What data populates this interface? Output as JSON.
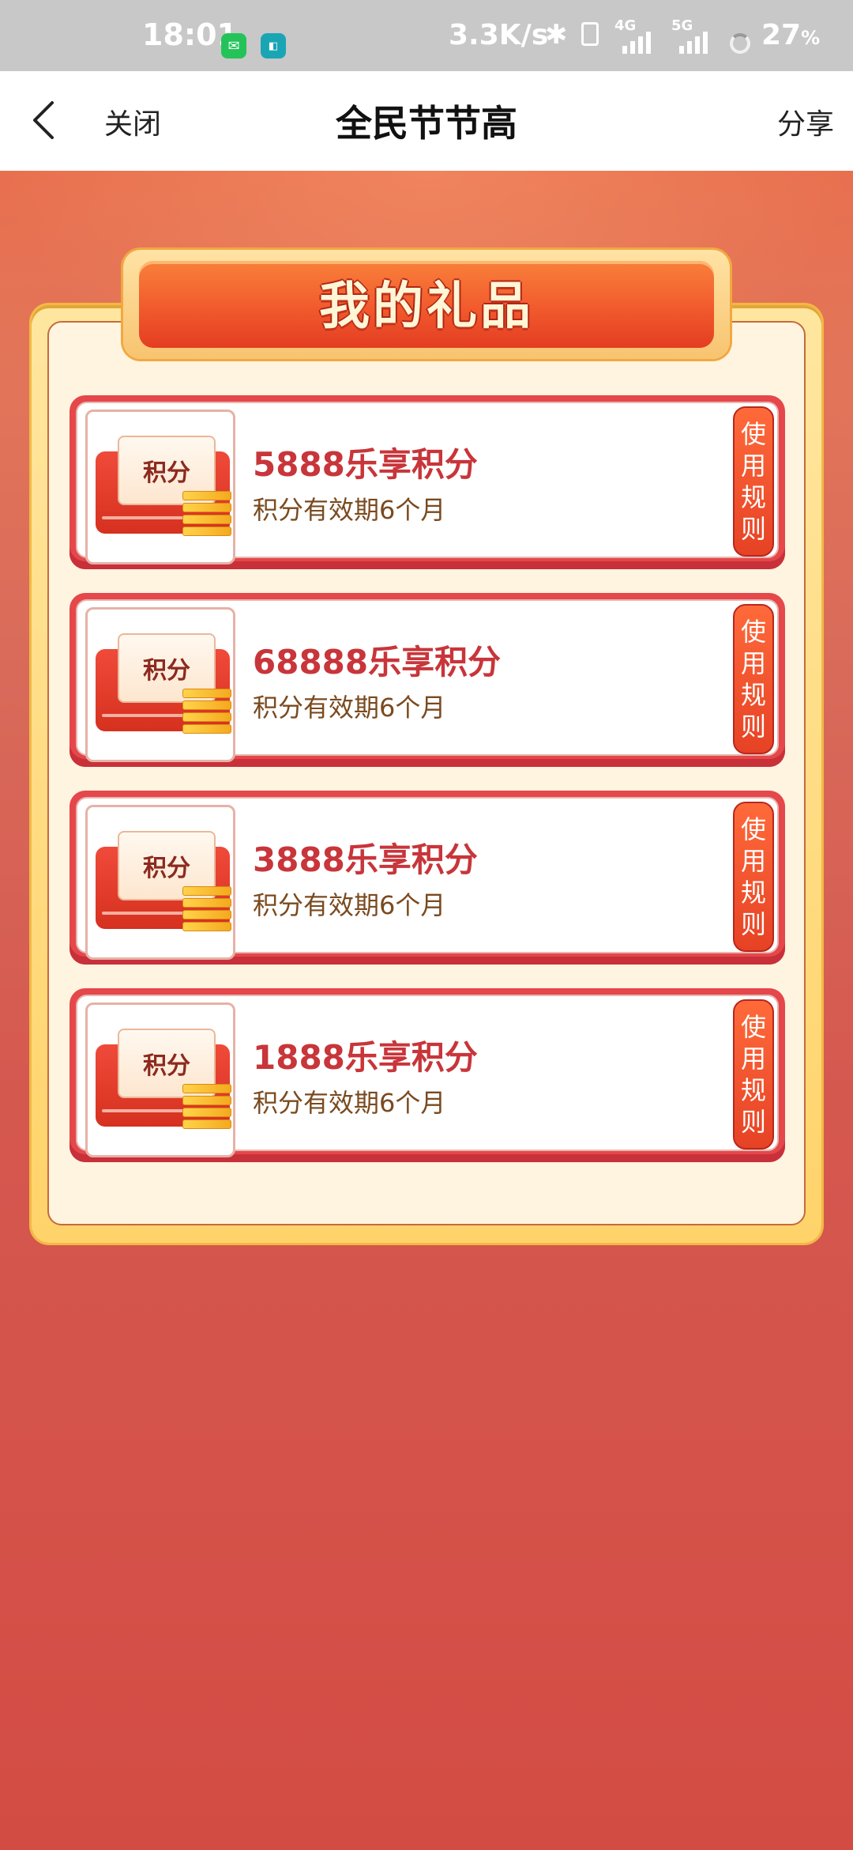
{
  "status": {
    "time": "18:01",
    "speed": "3.3K/s",
    "net1": "4G",
    "net2": "5G",
    "battery": "27",
    "battery_unit": "%"
  },
  "nav": {
    "close_label": "关闭",
    "title": "全民节节高",
    "share_label": "分享"
  },
  "panel": {
    "title": "我的礼品"
  },
  "gifts": [
    {
      "thumb_label": "积分",
      "title": "5888乐享积分",
      "subtitle": "积分有效期6个月",
      "rule": [
        "使",
        "用",
        "规",
        "则"
      ]
    },
    {
      "thumb_label": "积分",
      "title": "68888乐享积分",
      "subtitle": "积分有效期6个月",
      "rule": [
        "使",
        "用",
        "规",
        "则"
      ]
    },
    {
      "thumb_label": "积分",
      "title": "3888乐享积分",
      "subtitle": "积分有效期6个月",
      "rule": [
        "使",
        "用",
        "规",
        "则"
      ]
    },
    {
      "thumb_label": "积分",
      "title": "1888乐享积分",
      "subtitle": "积分有效期6个月",
      "rule": [
        "使",
        "用",
        "规",
        "则"
      ]
    }
  ],
  "colors": {
    "brand_red": "#d34c44",
    "title_red": "#c8353a",
    "gold": "#ffd36a"
  },
  "icons": {
    "back": "chevron-left-icon",
    "wechat": "wechat-icon",
    "bluetooth": "bluetooth-icon",
    "vibrate": "vibrate-icon",
    "signal": "signal-icon",
    "loading": "loading-ring-icon"
  }
}
